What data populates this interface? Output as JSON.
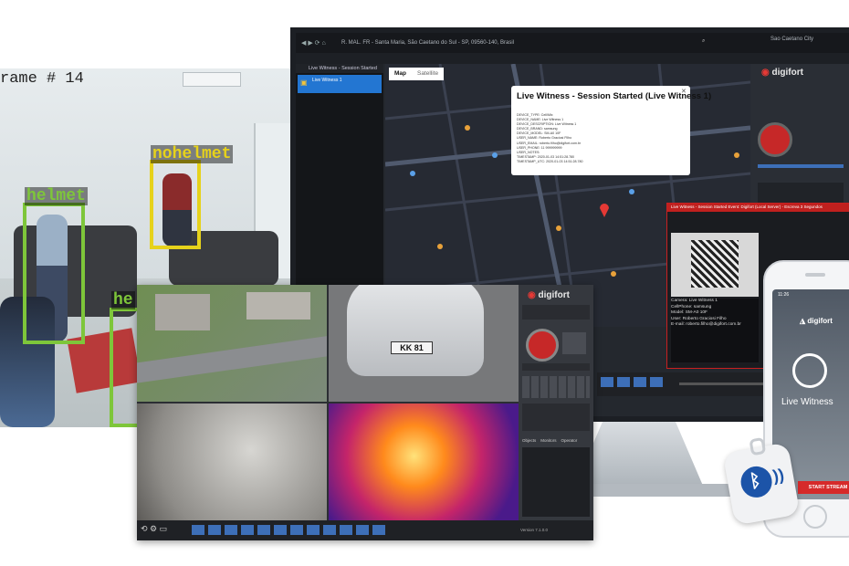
{
  "camera_feed": {
    "frame_text": "rame # 14",
    "detections": [
      {
        "label": "helmet",
        "color": "#7ec63a"
      },
      {
        "label": "nohelmet",
        "color": "#e6d21b"
      },
      {
        "label": "he",
        "color": "#7ec63a"
      }
    ]
  },
  "monitor": {
    "address_text": "R. MAL. FR - Santa Maria, São Caetano do Sul - SP, 09560-140, Brasil",
    "top_right_text": "Sao Caetano City",
    "sidebar_title": "Live Witness - Session Started",
    "sidebar_item": "Live Witness 1",
    "map_tabs": [
      "Map",
      "Satellite"
    ],
    "popup": {
      "title": "Live Witness - Session Started (Live Witness 1)",
      "fields": [
        "DEVICE_TYPE: Cell/Mix",
        "DEVICE_NAME: Live Witness 1",
        "DEVICE_DESCRIPTION: Live Witness 1",
        "DEVICE_BRAND: samsung",
        "DEVICE_MODEL: SM-A0 10F",
        "USER_NAME: Roberto Graciosi Filho",
        "USER_EMAIL: roberto.filho@digifort.com.br",
        "USER_PHONE: 11 999999999",
        "USER_NOTES:",
        "TIMESTAMP: 2020-01-03 14:51:28.780",
        "TIMESTAMP_UTC: 2020-01-03 14:51:28.780"
      ]
    },
    "logo": "digifort",
    "alert": {
      "header": "Live Witness - Session Started Event: Digifort (Local Server) - Escreva 3 Segundos",
      "info_lines": [
        "Camera: Live Witness 1",
        "CellPhone: samsung",
        "Model: SM-A0 10F",
        "User: Roberto Graciosi Filho",
        "E-mail: roberto.filho@digifort.com.br"
      ],
      "waiting_text": "Waiting for video input..."
    }
  },
  "front_window": {
    "logo": "digifort",
    "plate_text": "KK 81",
    "menu_items": [
      "Objects",
      "Monitors",
      "Operator"
    ],
    "version_text": "Version 7.1.0.0",
    "toolbar_buttons": 12
  },
  "phone": {
    "time": "11:26",
    "logo": "digifort",
    "app_title": "Live Witness",
    "button": "START STREAM",
    "accent": "#d62a2a"
  },
  "colors": {
    "map_bg": "#262a33",
    "alert_red": "#c0201e",
    "bluetooth_blue": "#1c54a8",
    "tool_blue": "#3d6fb8"
  }
}
